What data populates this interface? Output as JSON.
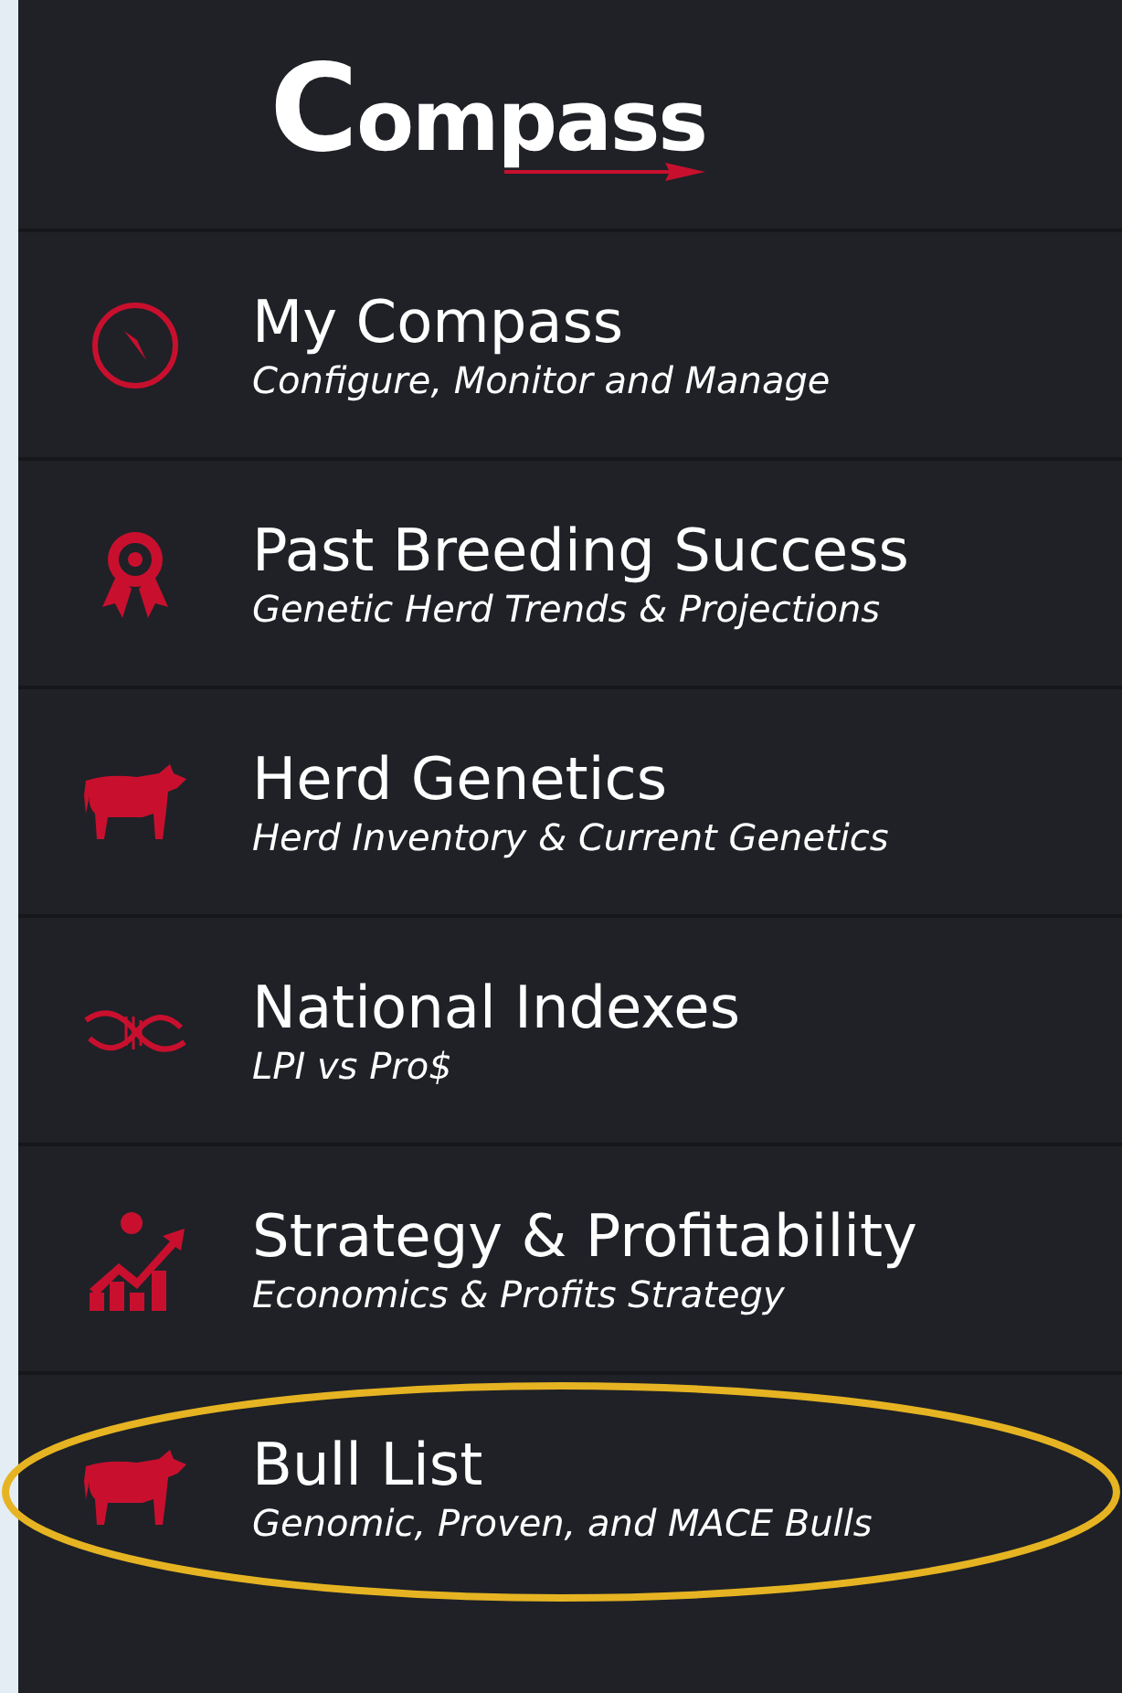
{
  "logo": {
    "text": "Compass"
  },
  "menu": [
    {
      "kind": "compass",
      "title": "My Compass",
      "subtitle": "Configure, Monitor and Manage",
      "highlighted": false
    },
    {
      "kind": "ribbon",
      "title": "Past Breeding Success",
      "subtitle": "Genetic Herd Trends & Projections",
      "highlighted": false
    },
    {
      "kind": "cow",
      "title": "Herd Genetics",
      "subtitle": "Herd Inventory & Current Genetics",
      "highlighted": false
    },
    {
      "kind": "dna",
      "title": "National Indexes",
      "subtitle": "LPI vs Pro$",
      "highlighted": false
    },
    {
      "kind": "chart",
      "title": "Strategy & Profitability",
      "subtitle": "Economics & Profits Strategy",
      "highlighted": false
    },
    {
      "kind": "cow",
      "title": "Bull List",
      "subtitle": "Genomic, Proven, and MACE Bulls",
      "highlighted": true
    }
  ]
}
